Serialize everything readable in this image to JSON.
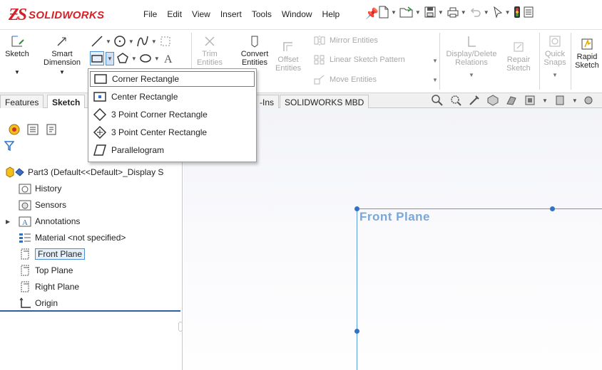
{
  "app": {
    "brand_ds": "ƵS",
    "brand_name": "SOLIDWORKS"
  },
  "menu": [
    "File",
    "Edit",
    "View",
    "Insert",
    "Tools",
    "Window",
    "Help"
  ],
  "ribbon": {
    "sketch": "Sketch",
    "smart_dimension_1": "Smart",
    "smart_dimension_2": "Dimension",
    "trim_1": "Trim",
    "trim_2": "Entities",
    "convert_1": "Convert",
    "convert_2": "Entities",
    "offset_1": "Offset",
    "offset_2": "Entities",
    "mirror": "Mirror Entities",
    "linear_pattern": "Linear Sketch Pattern",
    "move": "Move Entities",
    "display_delete_1": "Display/Delete",
    "display_delete_2": "Relations",
    "repair_1": "Repair",
    "repair_2": "Sketch",
    "quick_snaps_1": "Quick",
    "quick_snaps_2": "Snaps",
    "rapid_1": "Rapid",
    "rapid_2": "Sketch"
  },
  "tabs": {
    "features": "Features",
    "sketch": "Sketch",
    "addins": "-Ins",
    "mbd": "SOLIDWORKS MBD"
  },
  "dropdown": [
    "Corner Rectangle",
    "Center Rectangle",
    "3 Point Corner Rectangle",
    "3 Point Center Rectangle",
    "Parallelogram"
  ],
  "tree": {
    "root": "Part3  (Default<<Default>_Display S",
    "history": "History",
    "sensors": "Sensors",
    "annotations": "Annotations",
    "material": "Material <not specified>",
    "front_plane": "Front Plane",
    "top_plane": "Top Plane",
    "right_plane": "Right Plane",
    "origin": "Origin"
  },
  "graphics": {
    "plane_label": "Front Plane"
  },
  "colors": {
    "brand": "#d71f27",
    "selection": "#4d8fd6",
    "plane": "#5b9be0"
  }
}
